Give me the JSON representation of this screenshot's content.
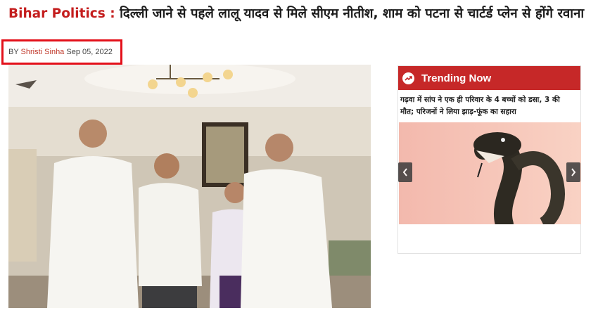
{
  "article": {
    "category_tag": "Bihar Politics :",
    "headline": "दिल्ली जाने से पहले लालू यादव से मिले सीएम नीतीश, शाम को पटना से चार्टर्ड प्लेन से होंगे रवाना",
    "by_label": "BY",
    "author": "Shristi Sinha",
    "date": "Sep 05, 2022"
  },
  "trending": {
    "title": "Trending Now",
    "item_text": "गढ़वा में सांप ने एक ही परिवार के 4 बच्चों को डसा, 3 की मौत; परिजनों ने लिया झाड़-फूंक का सहारा",
    "prev_icon": "chevron-left-icon",
    "next_icon": "chevron-right-icon"
  },
  "colors": {
    "accent_red": "#c62828",
    "tag_red": "#c41e1e",
    "highlight_box": "#e3101a",
    "author_link": "#c0392b"
  }
}
